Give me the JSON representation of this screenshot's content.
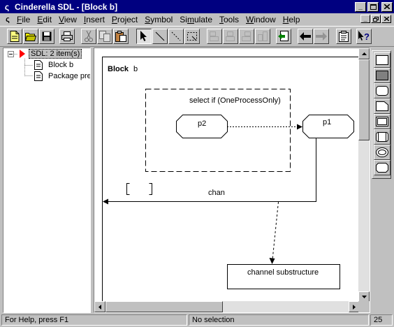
{
  "window": {
    "title": "Cinderella SDL - [Block b]",
    "minimize": "_",
    "maximize": "□",
    "close": "×",
    "doc_restore": "🗗"
  },
  "menu": [
    {
      "label": "File",
      "key": "F"
    },
    {
      "label": "Edit",
      "key": "E"
    },
    {
      "label": "View",
      "key": "V"
    },
    {
      "label": "Insert",
      "key": "I"
    },
    {
      "label": "Project",
      "key": "P"
    },
    {
      "label": "Symbol",
      "key": "S"
    },
    {
      "label": "Simulate",
      "key": "m"
    },
    {
      "label": "Tools",
      "key": "T"
    },
    {
      "label": "Window",
      "key": "W"
    },
    {
      "label": "Help",
      "key": "H"
    }
  ],
  "toolbar": {
    "buttons": [
      "new-file",
      "open-folder",
      "save",
      "print",
      "cut",
      "copy",
      "paste",
      "select-pointer",
      "line-tool",
      "dashed-line-tool",
      "frame-tool",
      "align-left",
      "align-center",
      "align-right",
      "add-item",
      "back-arrow",
      "forward-arrow",
      "properties",
      "context-help"
    ]
  },
  "tree": {
    "root": "SDL: 2 item(s)",
    "items": [
      "Block b",
      "Package pre"
    ]
  },
  "diagram": {
    "block_keyword": "Block",
    "block_name": "b",
    "select_label": "select if (OneProcessOnly)",
    "process_p2": "p2",
    "process_p1": "p1",
    "channel_label": "chan",
    "substructure_label": "channel substructure"
  },
  "status": {
    "help": "For Help, press F1",
    "selection": "No selection",
    "number": "25"
  },
  "colors": {
    "titlebar": "#000080",
    "tree_marker": "#ff0000",
    "face": "#c0c0c0"
  }
}
